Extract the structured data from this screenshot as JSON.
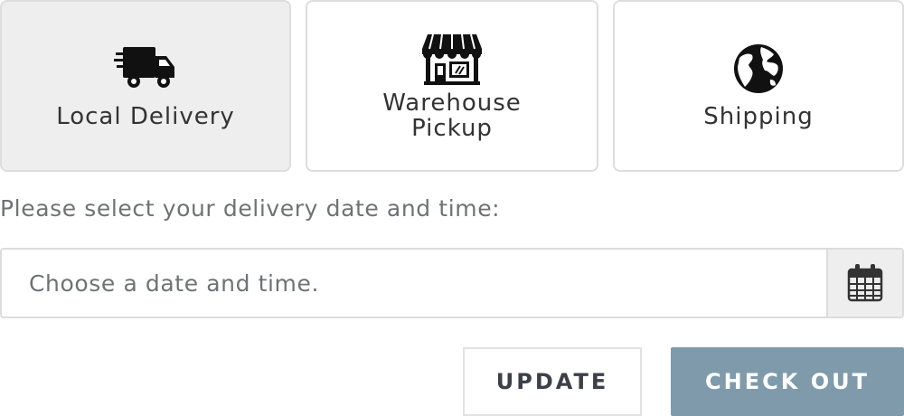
{
  "delivery_options": [
    {
      "label": "Local Delivery",
      "icon": "truck-icon",
      "selected": true
    },
    {
      "label_line1": "Warehouse",
      "label_line2": "Pickup",
      "icon": "storefront-icon",
      "selected": false
    },
    {
      "label": "Shipping",
      "icon": "globe-icon",
      "selected": false
    }
  ],
  "prompt": "Please select your delivery date and time:",
  "date_field": {
    "placeholder": "Choose a date and time.",
    "icon": "calendar-icon"
  },
  "buttons": {
    "update": "UPDATE",
    "checkout": "CHECK OUT"
  },
  "colors": {
    "selected_bg": "#eeeeee",
    "checkout_bg": "#7f9bab",
    "border": "#dddddd"
  }
}
